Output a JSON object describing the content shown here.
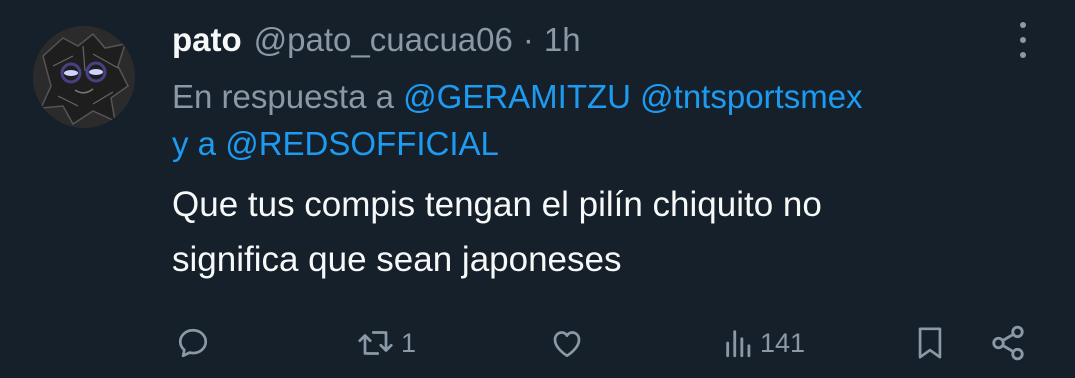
{
  "tweet": {
    "display_name": "pato",
    "handle": "@pato_cuacua06",
    "separator": "·",
    "time": "1h",
    "reply_prefix": "En respuesta a",
    "mentions": [
      "@GERAMITZU",
      "@tntsportsmex",
      "@REDSOFFICIAL"
    ],
    "reply_connector": "y a",
    "text_line1": "Que tus compis tengan el pilín chiquito no",
    "text_line2": "significa que sean japoneses"
  },
  "actions": {
    "reply_icon": "reply-icon",
    "retweet_icon": "retweet-icon",
    "retweet_count": "1",
    "like_icon": "heart-icon",
    "views_icon": "views-icon",
    "views_count": "141",
    "bookmark_icon": "bookmark-icon",
    "share_icon": "share-icon"
  },
  "colors": {
    "background": "#15202b",
    "text": "#f7f9f9",
    "secondary": "#8b98a5",
    "link": "#1d9bf0"
  }
}
